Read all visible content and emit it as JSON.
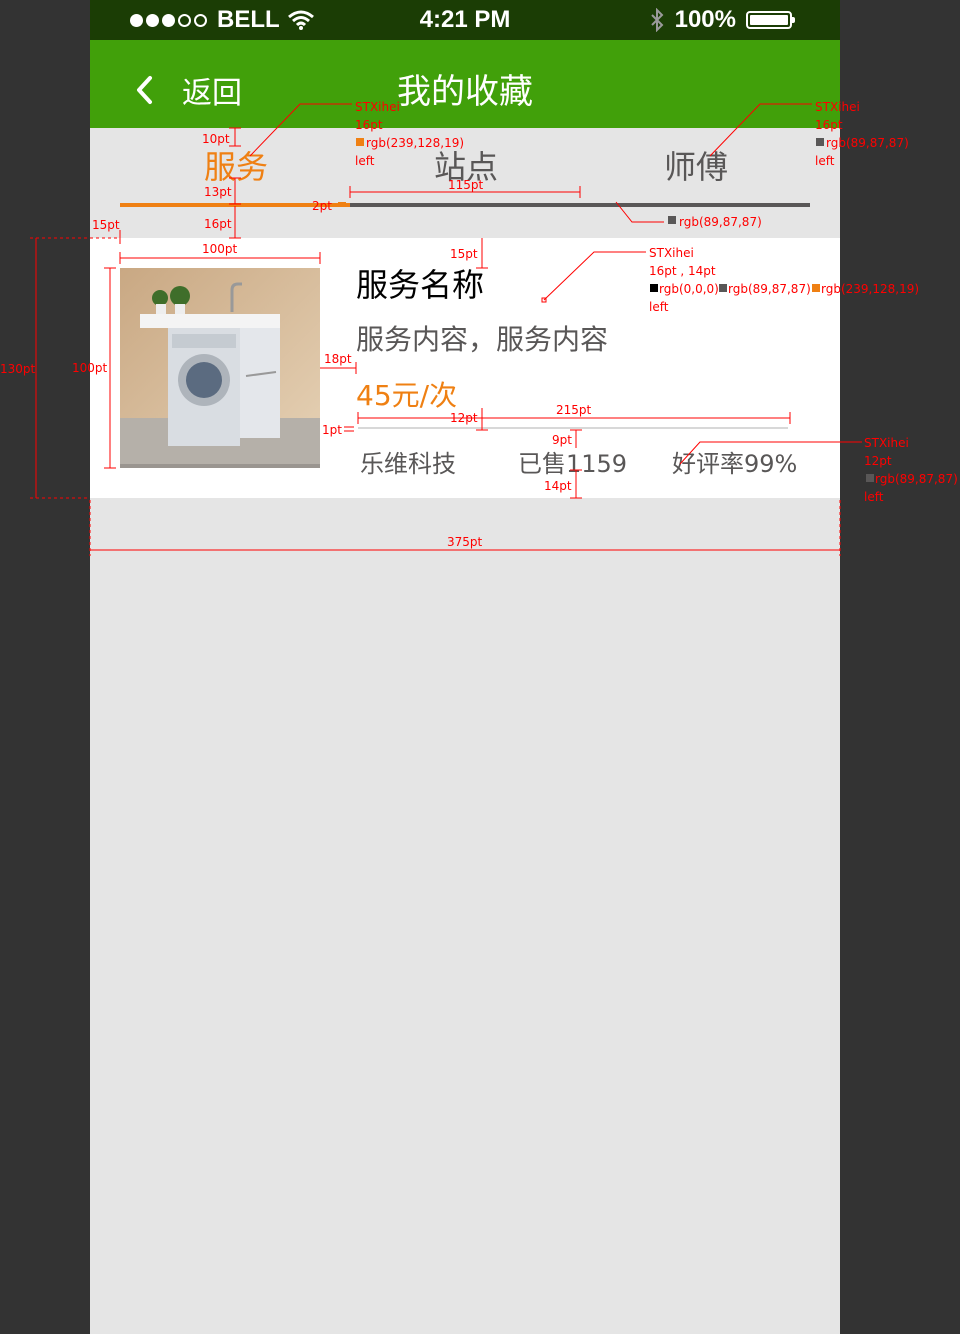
{
  "status_bar": {
    "carrier": "BELL",
    "time": "4:21 PM",
    "battery": "100%"
  },
  "nav": {
    "back_label": "返回",
    "title": "我的收藏"
  },
  "tabs": [
    {
      "label": "服务",
      "active": true
    },
    {
      "label": "站点",
      "active": false
    },
    {
      "label": "师傅",
      "active": false
    }
  ],
  "card": {
    "name": "服务名称",
    "description": "服务内容，服务内容",
    "price": "45元/次",
    "provider": "乐维科技",
    "sold": "已售1159",
    "rating": "好评率99%"
  },
  "annotations": {
    "tab_spec": {
      "font": "STXihei",
      "size": "16pt",
      "color": "rgb(239,128,19)",
      "align": "left"
    },
    "tab_spec_2": {
      "font": "STXihei",
      "size": "16pt",
      "color": "rgb(89,87,87)",
      "align": "left"
    },
    "line_color": "rgb(89,87,87)",
    "card_spec": {
      "font": "STXihei",
      "size": "16pt , 14pt",
      "color1": "rgb(0,0,0)",
      "color2": "rgb(89,87,87)",
      "color3": "rgb(239,128,19)",
      "align": "left"
    },
    "meta_spec": {
      "font": "STXihei",
      "size": "12pt",
      "color": "rgb(89,87,87)",
      "align": "left"
    },
    "dims": {
      "d10": "10pt",
      "d13": "13pt",
      "d16": "16pt",
      "d15a": "15pt",
      "d2": "2pt",
      "d115": "115pt",
      "d100w": "100pt",
      "d15b": "15pt",
      "d130": "130pt",
      "d100h": "100pt",
      "d18": "18pt",
      "d12": "12pt",
      "d215": "215pt",
      "d1": "1pt",
      "d9": "9pt",
      "d14": "14pt",
      "d375": "375pt"
    }
  },
  "colors": {
    "green": "#41a00a",
    "orange": "rgb(239,128,19)",
    "gray": "rgb(89,87,87)"
  }
}
